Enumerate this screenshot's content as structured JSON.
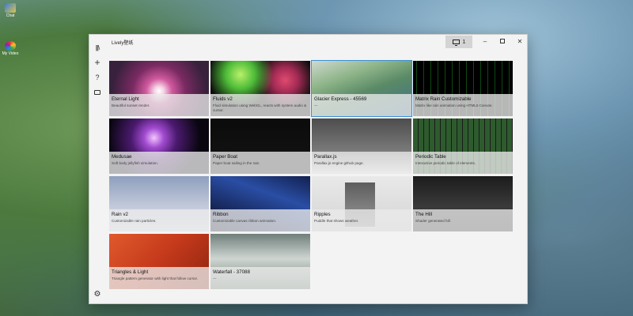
{
  "desktop": {
    "icons": [
      {
        "label": "Chat",
        "icon": "app-shortcut-icon"
      },
      {
        "label": "My Video",
        "icon": "colorful-app-icon"
      }
    ]
  },
  "window": {
    "title": "Lively壁纸",
    "monitor_count": "1",
    "controls": {
      "minimize": "–",
      "maximize": "",
      "close": "✕"
    }
  },
  "sidebar": {
    "items": [
      {
        "name": "library",
        "glyph": "|||\\"
      },
      {
        "name": "add",
        "glyph": "+"
      },
      {
        "name": "help",
        "glyph": "?"
      },
      {
        "name": "chat",
        "glyph": ""
      }
    ],
    "settings_glyph": "⚙"
  },
  "wallpapers": [
    {
      "name": "Eternal Light",
      "desc": "Beautiful sunset render."
    },
    {
      "name": "Fluids v2",
      "desc": "Fluid simulation using WebGL, reacts with system audio & cursor."
    },
    {
      "name": "Glacier Express - 45569",
      "desc": "---",
      "selected": true
    },
    {
      "name": "Matrix Rain Customizable",
      "desc": "Matrix like rain animation using HTML5 Canvas."
    },
    {
      "name": "Medusae",
      "desc": "Soft body jellyfish simulation."
    },
    {
      "name": "Paper Boat",
      "desc": "Paper boat sailing in the rain."
    },
    {
      "name": "Parallax.js",
      "desc": "Parallax.js engine github page."
    },
    {
      "name": "Periodic Table",
      "desc": "Interactive periodic table of elements."
    },
    {
      "name": "Rain v2",
      "desc": "Customizable rain particles."
    },
    {
      "name": "Ribbon",
      "desc": "Customizable canvas ribbon animation."
    },
    {
      "name": "Ripples",
      "desc": "Puddle that shows weather."
    },
    {
      "name": "The Hill",
      "desc": "Shader generated hill."
    },
    {
      "name": "Triangles & Light",
      "desc": "Triangle pattern generator with light that follow cursor."
    },
    {
      "name": "Waterfall - 37088",
      "desc": "---"
    }
  ],
  "colors": {
    "selected_outline": "#3c8fd6",
    "window_bg": "#f3f3f3"
  }
}
